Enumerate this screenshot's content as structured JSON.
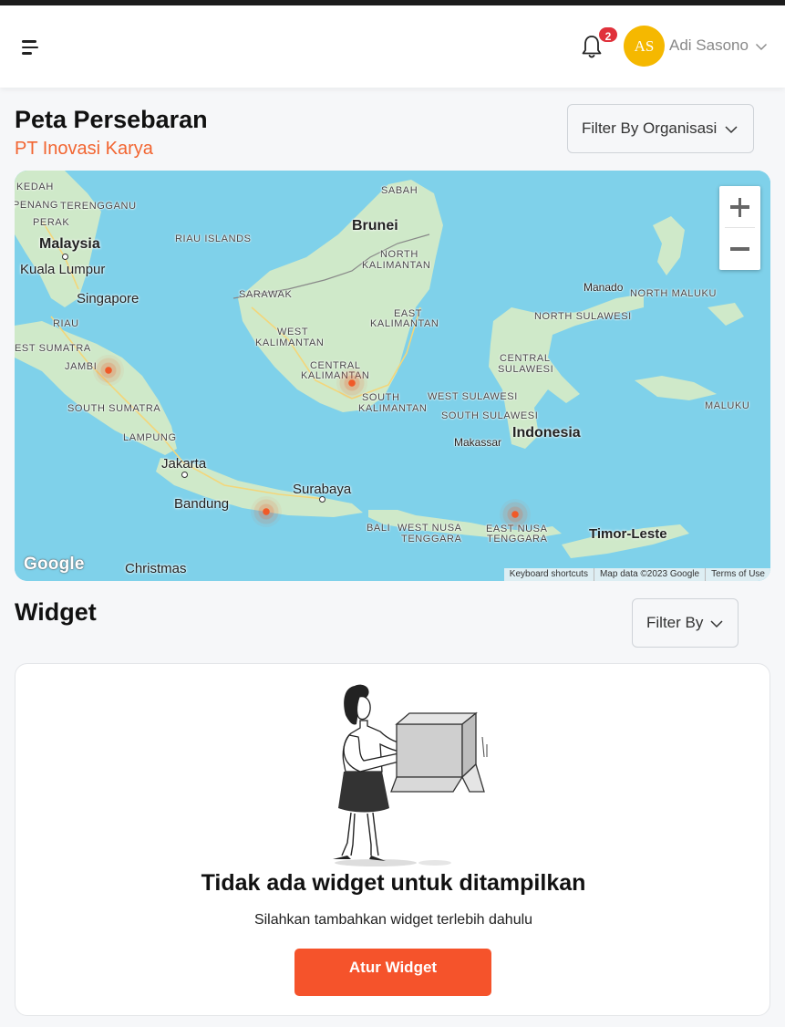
{
  "header": {
    "notification_count": "2",
    "user": {
      "initials": "AS",
      "name": "Adi Sasono"
    },
    "colors": {
      "avatar": "#f5b800",
      "badge": "#e0313b",
      "header_bg": "#ffffff"
    },
    "icons": [
      "menu-icon",
      "bell-icon",
      "chevron-down-icon"
    ]
  },
  "map_section": {
    "title": "Peta Persebaran",
    "organization": "PT Inovasi Karya",
    "filter_label": "Filter By Organisasi",
    "zoom_in": "+",
    "zoom_out": "−",
    "google_logo": "Google",
    "attribution": {
      "shortcuts": "Keyboard shortcuts",
      "data": "Map data ©2023 Google",
      "terms": "Terms of Use"
    },
    "labels": {
      "kedah": "KEDAH",
      "penang": "PENANG",
      "terengganu": "TERENGGANU",
      "perak": "PERAK",
      "malaysia": "Malaysia",
      "kuala_lumpur": "Kuala Lumpur",
      "riau_islands": "RIAU ISLANDS",
      "singapore": "Singapore",
      "riau": "RIAU",
      "west_sumatra": "EST SUMATRA",
      "jambi": "JAMBI",
      "south_sumatra": "SOUTH SUMATRA",
      "lampung": "LAMPUNG",
      "jakarta": "Jakarta",
      "bandung": "Bandung",
      "christmas": "Christmas",
      "sabah": "SABAH",
      "brunei": "Brunei",
      "north_kalimantan_1": "NORTH",
      "north_kalimantan_2": "KALIMANTAN",
      "sarawak": "SARAWAK",
      "west_kalimantan_1": "WEST",
      "west_kalimantan_2": "KALIMANTAN",
      "east_kalimantan_1": "EAST",
      "east_kalimantan_2": "KALIMANTAN",
      "central_kalimantan_1": "CENTRAL",
      "central_kalimantan_2": "KALIMANTAN",
      "south_kalimantan_1": "SOUTH",
      "south_kalimantan_2": "KALIMANTAN",
      "surabaya": "Surabaya",
      "bali": "BALI",
      "west_nusa_1": "WEST NUSA",
      "west_nusa_2": "TENGGARA",
      "east_nusa_1": "EAST NUSA",
      "east_nusa_2": "TENGGARA",
      "manado": "Manado",
      "north_maluku": "NORTH MALUKU",
      "north_sulawesi": "NORTH SULAWESI",
      "central_sulawesi_1": "CENTRAL",
      "central_sulawesi_2": "SULAWESI",
      "west_sulawesi": "WEST SULAWESI",
      "south_sulawesi": "SOUTH SULAWESI",
      "indonesia": "Indonesia",
      "makassar": "Makassar",
      "maluku": "MALUKU",
      "timor_leste": "Timor-Leste"
    },
    "markers": [
      "Jambi",
      "Central Kalimantan",
      "Central Java",
      "East Nusa Tenggara"
    ],
    "colors": {
      "water": "#7fd1ea",
      "land": "#cfe9c9",
      "marker": "#f05a28"
    }
  },
  "widget_section": {
    "title": "Widget",
    "filter_label": "Filter By",
    "empty_title": "Tidak ada widget untuk ditampilkan",
    "empty_subtitle": "Silahkan tambahkan widget terlebih dahulu",
    "cta_label": "Atur Widget",
    "colors": {
      "cta": "#f5532b"
    }
  }
}
